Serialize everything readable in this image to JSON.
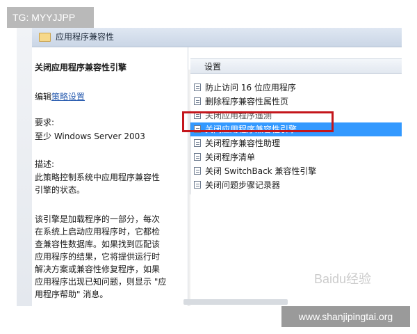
{
  "tag_label": "TG: MYYJJPP",
  "window": {
    "title": "应用程序兼容性",
    "title_icon": "folder-icon"
  },
  "description": {
    "title": "关闭应用程序兼容性引擎",
    "edit_prefix": "编辑",
    "edit_link": "策略设置",
    "requirements_label": "要求:",
    "requirements_value": "至少 Windows Server 2003",
    "description_label": "描述:",
    "paragraph1": " 此策略控制系统中应用程序兼容性引擎的状态。",
    "paragraph2": "该引擎是加载程序的一部分，每次在系统上启动应用程序时，它都检查兼容性数据库。如果找到匹配该应用程序的结果，它将提供运行时解决方案或兼容性修复程序，如果应用程序出现已知问题，则显示 \"应用程序帮助\" 消息。"
  },
  "settings": {
    "header": "设置",
    "items": [
      {
        "label": "防止访问 16 位应用程序",
        "icon": "policy-setting-icon"
      },
      {
        "label": "删除程序兼容性属性页",
        "icon": "policy-setting-icon"
      },
      {
        "label": "关闭应用程序遥测",
        "icon": "policy-setting-icon"
      },
      {
        "label": "关闭应用程序兼容性引擎",
        "icon": "policy-setting-icon",
        "selected": true
      },
      {
        "label": "关闭程序兼容性助理",
        "icon": "policy-setting-icon"
      },
      {
        "label": "关闭程序清单",
        "icon": "policy-setting-icon"
      },
      {
        "label": "关闭 SwitchBack 兼容性引擎",
        "icon": "policy-setting-icon"
      },
      {
        "label": "关闭问题步骤记录器",
        "icon": "policy-setting-icon"
      }
    ]
  },
  "watermark": "Baidu经验",
  "footer_label": "www.shanjipingtai.org",
  "colors": {
    "selection": "#3399ff",
    "highlight_box": "#c4161c",
    "link": "#2a5db0"
  }
}
